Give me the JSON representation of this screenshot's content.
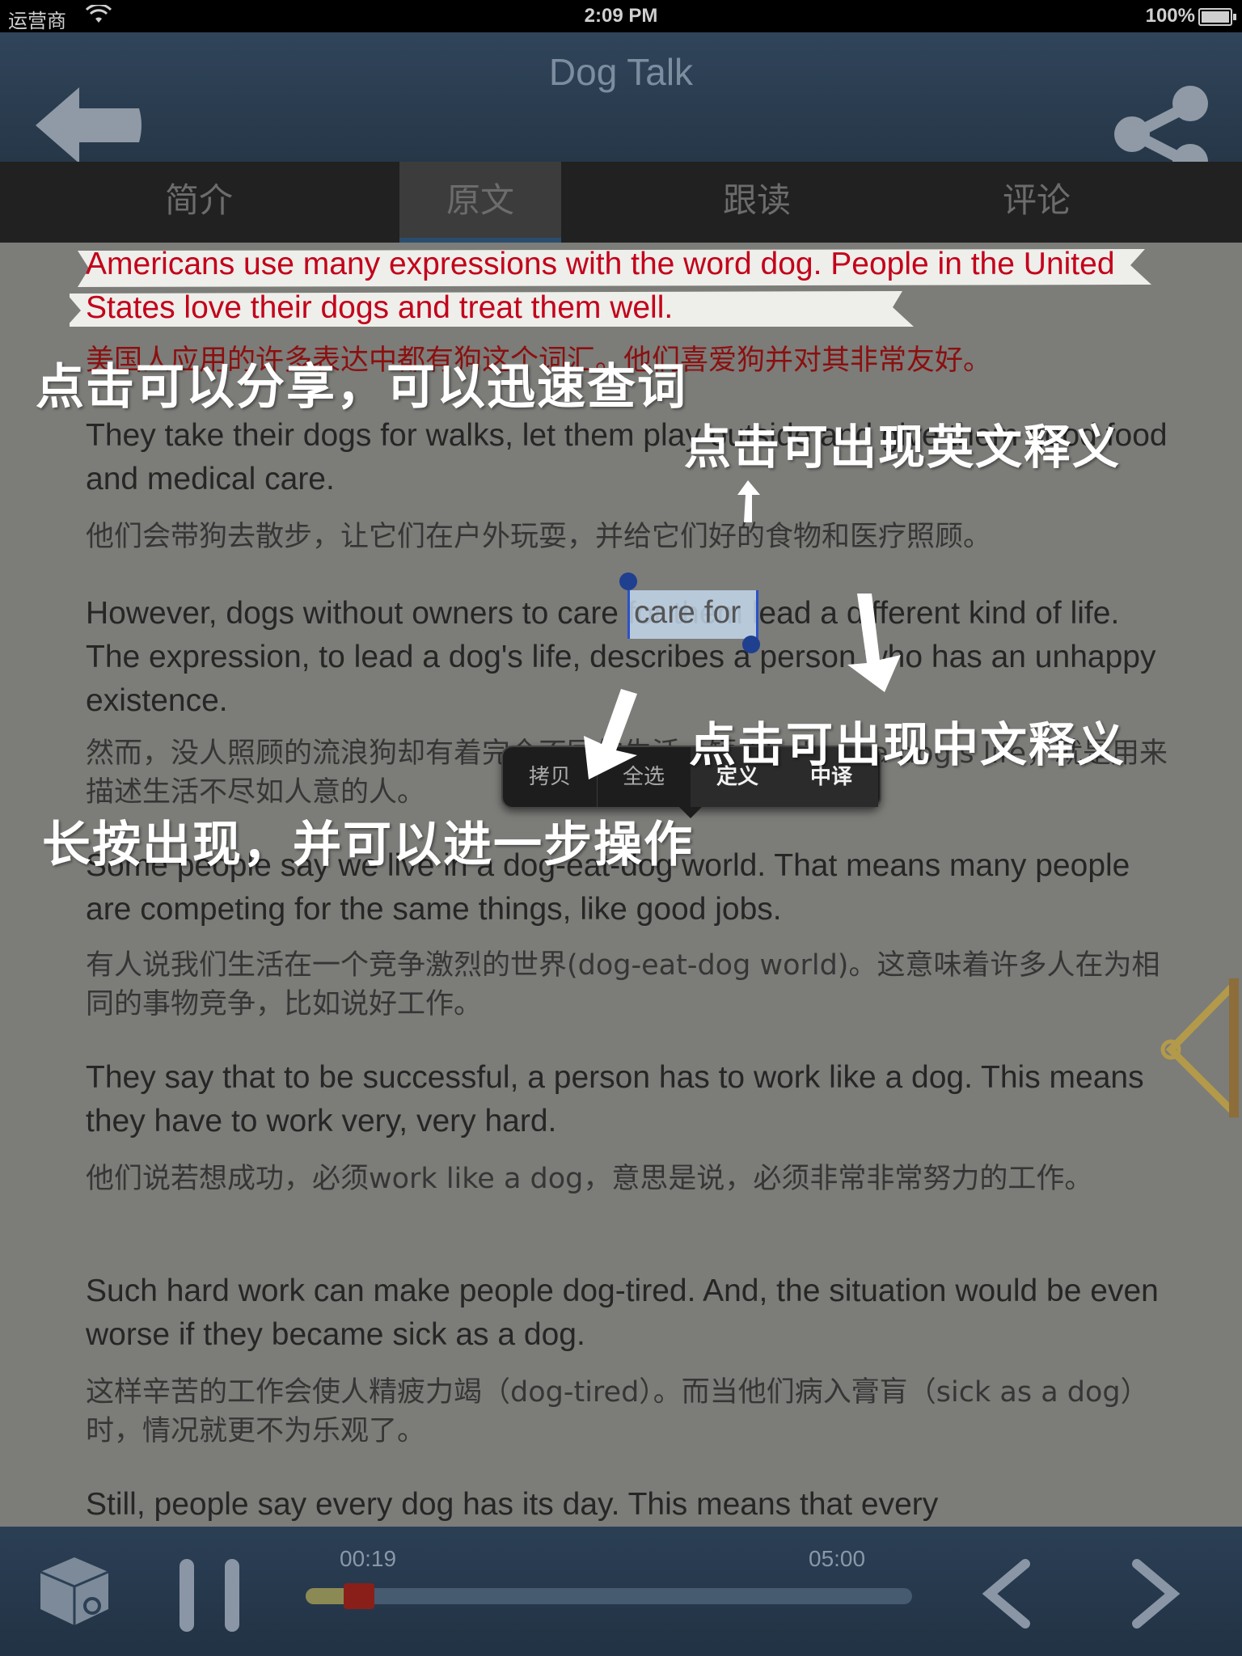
{
  "status": {
    "carrier": "运营商",
    "time": "2:09 PM",
    "battery": "100%"
  },
  "nav": {
    "title": "Dog Talk"
  },
  "tabs": [
    {
      "label": "简介"
    },
    {
      "label": "原文"
    },
    {
      "label": "跟读"
    },
    {
      "label": "评论"
    }
  ],
  "active_tab": 1,
  "text": {
    "p1_en": "Americans use many expressions with the word dog. People in the United States love their dogs and treat them well.",
    "p1_zh": "美国人应用的许多表达中都有狗这个词汇。他们喜爱狗并对其非常友好。",
    "p2_en": "They take their dogs for walks, let them play outside and give them good food and medical care.",
    "p2_zh": "他们会带狗去散步，让它们在户外玩耍，并给它们好的食物和医疗照顾。",
    "p3_en": "However, dogs without owners to care for them lead a different kind of life. The expression, to lead a dog's life, describes a person who has an unhappy existence.",
    "p3_zh": "然而，没人照顾的流浪狗却有着完全不同的生活。短语to lead a dog's life，就是用来描述生活不尽如人意的人。",
    "p4_en": "Some people say we live in a dog-eat-dog world. That means many people are competing for the same things, like good jobs.",
    "p4_zh": "有人说我们生活在一个竞争激烈的世界(dog-eat-dog world)。这意味着许多人在为相同的事物竞争，比如说好工作。",
    "p5_en": "They say that to be successful, a person has to work like a dog. This means they have to work very, very hard.",
    "p5_zh": "他们说若想成功，必须work like a dog，意思是说，必须非常非常努力的工作。",
    "p6_en": "Such hard work can make people dog-tired. And, the situation would be even worse if they became sick as a dog.",
    "p6_zh": "这样辛苦的工作会使人精疲力竭（dog-tired）。而当他们病入膏肓（sick as a dog）时，情况就更不为乐观了。",
    "p7_en": "Still, people say every dog has its day. This means that every",
    "selected_word": "care for"
  },
  "edit_menu": [
    {
      "label": "拷贝"
    },
    {
      "label": "全选"
    },
    {
      "label": "定义"
    },
    {
      "label": "中译"
    }
  ],
  "annotations": {
    "share": "点击可以分享，可以迅速查词",
    "define": "点击可出现英文释义",
    "translate": "点击可出现中文释义",
    "longpress": "长按出现，并可以进一步操作"
  },
  "player": {
    "current": "00:19",
    "total": "05:00",
    "progress": 0.063
  },
  "colors": {
    "nav": "#30445a",
    "highlight_text": "#c3001a",
    "accent": "#2a52c8"
  }
}
